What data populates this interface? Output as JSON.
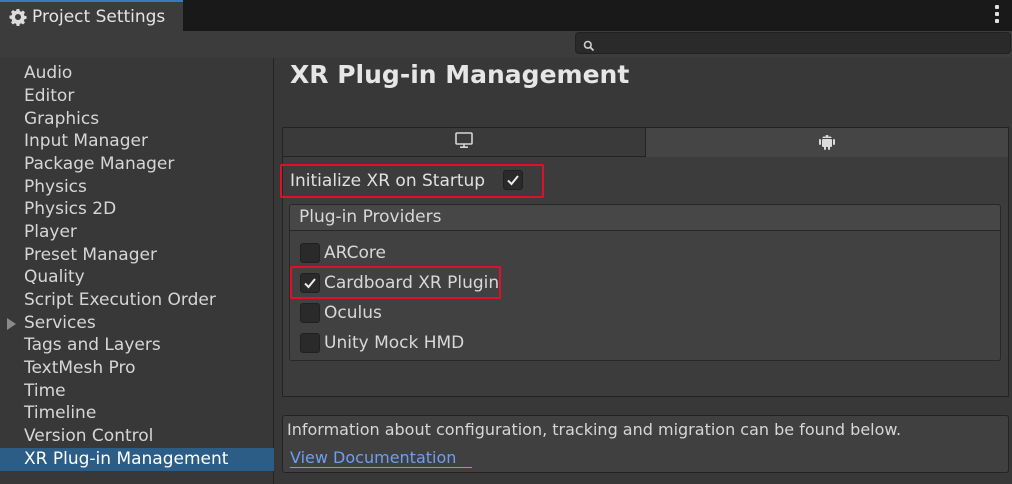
{
  "window": {
    "tab_title": "Project Settings",
    "tab_icon": "gear-icon"
  },
  "search": {
    "value": "",
    "icon": "search-icon"
  },
  "sidebar": {
    "items": [
      {
        "label": "Audio",
        "selected": false
      },
      {
        "label": "Editor",
        "selected": false
      },
      {
        "label": "Graphics",
        "selected": false
      },
      {
        "label": "Input Manager",
        "selected": false
      },
      {
        "label": "Package Manager",
        "selected": false
      },
      {
        "label": "Physics",
        "selected": false
      },
      {
        "label": "Physics 2D",
        "selected": false
      },
      {
        "label": "Player",
        "selected": false
      },
      {
        "label": "Preset Manager",
        "selected": false
      },
      {
        "label": "Quality",
        "selected": false
      },
      {
        "label": "Script Execution Order",
        "selected": false
      },
      {
        "label": "Services",
        "selected": false,
        "expandable": true
      },
      {
        "label": "Tags and Layers",
        "selected": false
      },
      {
        "label": "TextMesh Pro",
        "selected": false
      },
      {
        "label": "Time",
        "selected": false
      },
      {
        "label": "Timeline",
        "selected": false
      },
      {
        "label": "Version Control",
        "selected": false
      },
      {
        "label": "XR Plug-in Management",
        "selected": true
      }
    ]
  },
  "main": {
    "title": "XR Plug-in Management",
    "platform_tabs": [
      {
        "icon": "monitor-icon",
        "platform": "Standalone",
        "active": false
      },
      {
        "icon": "android-icon",
        "platform": "Android",
        "active": true
      }
    ],
    "init_xr": {
      "label": "Initialize XR on Startup",
      "checked": true
    },
    "providers": {
      "header": "Plug-in Providers",
      "items": [
        {
          "label": "ARCore",
          "checked": false
        },
        {
          "label": "Cardboard XR Plugin",
          "checked": true
        },
        {
          "label": "Oculus",
          "checked": false
        },
        {
          "label": "Unity Mock HMD",
          "checked": false
        }
      ]
    },
    "info": {
      "text": "Information about configuration, tracking and migration can be found below.",
      "link_label": "View Documentation"
    }
  },
  "colors": {
    "selection": "#2c5d87",
    "highlight_border": "#e0102a",
    "link": "#6c9ff0",
    "tab_accent": "#3a79bb"
  }
}
